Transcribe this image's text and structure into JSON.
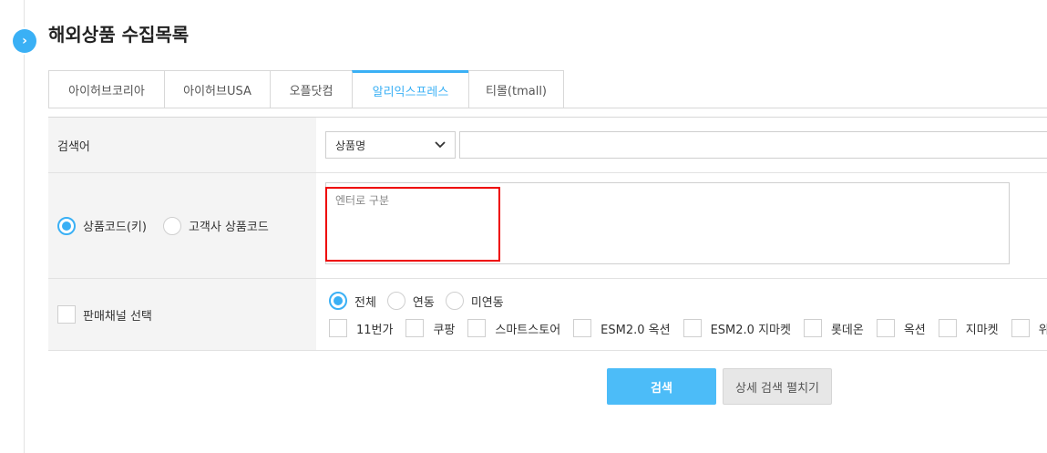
{
  "page": {
    "title": "해외상품 수집목록"
  },
  "toggle": {
    "icon": "›"
  },
  "tabs": [
    {
      "label": "아이허브코리아"
    },
    {
      "label": "아이허브USA"
    },
    {
      "label": "오플닷컴"
    },
    {
      "label": "알리익스프레스"
    },
    {
      "label": "티몰(tmall)"
    }
  ],
  "search": {
    "label": "검색어",
    "select_value": "상품명",
    "input_value": ""
  },
  "code": {
    "radio_product_code": "상품코드(키)",
    "radio_customer_code": "고객사 상품코드",
    "textarea_placeholder": "엔터로 구분"
  },
  "channel": {
    "checkbox_label": "판매채널 선택",
    "filter_all": "전체",
    "filter_linked": "연동",
    "filter_unlinked": "미연동",
    "items": [
      "11번가",
      "쿠팡",
      "스마트스토어",
      "ESM2.0 옥션",
      "ESM2.0 지마켓",
      "롯데온",
      "옥션",
      "지마켓",
      "위"
    ]
  },
  "buttons": {
    "search": "검색",
    "detail": "상세 검색 펼치기"
  },
  "colors": {
    "accent": "#3ab0f5",
    "highlight": "#e00000"
  }
}
